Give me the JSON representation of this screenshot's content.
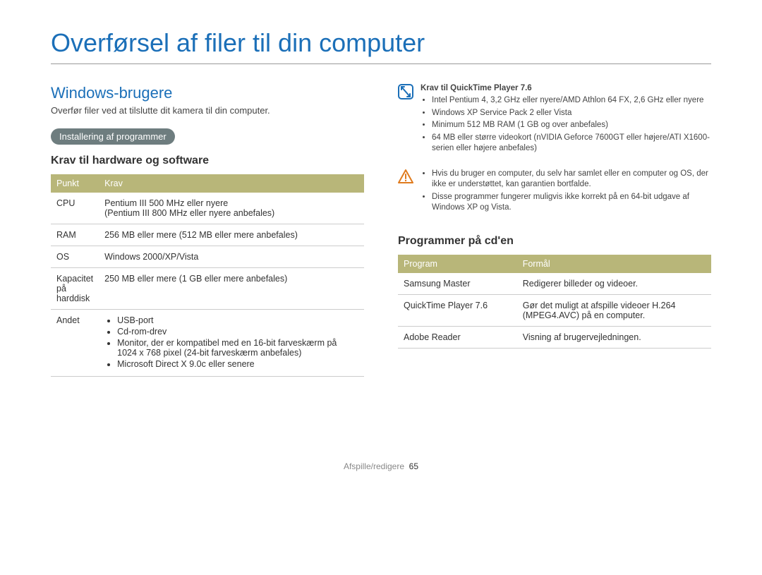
{
  "title": "Overførsel af filer til din computer",
  "section": {
    "heading": "Windows-brugere",
    "lead": "Overfør filer ved at tilslutte dit kamera til din computer.",
    "pill": "Installering af programmer",
    "subhead": "Krav til hardware og software"
  },
  "reqTable": {
    "headers": {
      "punkt": "Punkt",
      "krav": "Krav"
    },
    "rows": {
      "cpu": {
        "label": "CPU",
        "value": "Pentium III 500 MHz eller nyere\n(Pentium III 800 MHz eller nyere anbefales)"
      },
      "ram": {
        "label": "RAM",
        "value": "256 MB eller mere (512 MB eller mere anbefales)"
      },
      "os": {
        "label": "OS",
        "value": "Windows 2000/XP/Vista"
      },
      "disk": {
        "label": "Kapacitet på harddisk",
        "value": "250 MB eller mere (1 GB eller mere anbefales)"
      },
      "other": {
        "label": "Andet",
        "items": [
          "USB-port",
          "Cd-rom-drev",
          "Monitor, der er kompatibel med en 16-bit farveskærm på 1024 x 768 pixel (24-bit farveskærm anbefales)",
          "Microsoft Direct X 9.0c eller senere"
        ]
      }
    }
  },
  "qtNote": {
    "title": "Krav til QuickTime Player 7.6",
    "items": [
      "Intel Pentium 4, 3,2 GHz eller nyere/AMD Athlon 64 FX, 2,6 GHz eller nyere",
      "Windows XP Service Pack 2 eller Vista",
      "Minimum 512 MB RAM (1 GB og over anbefales)",
      "64 MB eller større videokort (nVIDIA Geforce 7600GT eller højere/ATI X1600-serien eller højere anbefales)"
    ]
  },
  "warnNote": {
    "items": [
      "Hvis du bruger en computer, du selv har samlet eller en computer og OS, der ikke er understøttet, kan garantien bortfalde.",
      "Disse programmer fungerer muligvis ikke korrekt på en 64-bit udgave af Windows XP og Vista."
    ]
  },
  "progSection": {
    "heading": "Programmer på cd'en",
    "headers": {
      "program": "Program",
      "formal": "Formål"
    },
    "rows": {
      "sm": {
        "label": "Samsung Master",
        "value": "Redigerer billeder og videoer."
      },
      "qt": {
        "label": "QuickTime Player 7.6",
        "value": "Gør det muligt at afspille videoer H.264 (MPEG4.AVC) på en computer."
      },
      "ar": {
        "label": "Adobe Reader",
        "value": "Visning af brugervejledningen."
      }
    }
  },
  "footer": {
    "section": "Afspille/redigere",
    "page": "65"
  }
}
